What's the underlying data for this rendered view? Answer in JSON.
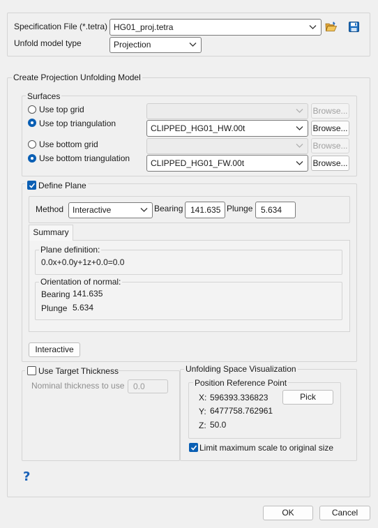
{
  "spec": {
    "label": "Specification File (*.tetra)",
    "value": "HG01_proj.tetra",
    "open_icon": "folder-open-icon",
    "save_icon": "save-icon"
  },
  "unfold": {
    "label": "Unfold model type",
    "value": "Projection"
  },
  "create": {
    "title": "Create Projection Unfolding Model",
    "surfaces": {
      "title": "Surfaces",
      "top_grid": {
        "label": "Use top grid",
        "value": "",
        "browse": "Browse...",
        "selected": false
      },
      "top_tri": {
        "label": "Use top triangulation",
        "value": "CLIPPED_HG01_HW.00t",
        "browse": "Browse...",
        "selected": true
      },
      "bottom_grid": {
        "label": "Use bottom grid",
        "value": "",
        "browse": "Browse...",
        "selected": false
      },
      "bottom_tri": {
        "label": "Use bottom triangulation",
        "value": "CLIPPED_HG01_FW.00t",
        "browse": "Browse...",
        "selected": true
      }
    },
    "define_plane": {
      "label": "Define Plane",
      "checked": true,
      "method_label": "Method",
      "method_value": "Interactive",
      "bearing_label": "Bearing",
      "bearing_value": "141.635",
      "plunge_label": "Plunge",
      "plunge_value": "5.634",
      "tab": "Summary",
      "plane_def_title": "Plane definition:",
      "plane_def_value": "0.0x+0.0y+1z+0.0=0.0",
      "normal_title": "Orientation of normal:",
      "normal_bearing_label": "Bearing",
      "normal_bearing_value": "141.635",
      "normal_plunge_label": "Plunge",
      "normal_plunge_value": "5.634",
      "interactive_button": "Interactive"
    },
    "target": {
      "label": "Use Target Thickness",
      "checked": false,
      "nominal_label": "Nominal thickness to use",
      "nominal_value": "0.0"
    },
    "visual": {
      "title": "Unfolding Space Visualization",
      "ref_title": "Position Reference Point",
      "x_label": "X:",
      "x_value": "596393.336823",
      "y_label": "Y:",
      "y_value": "6477758.762961",
      "z_label": "Z:",
      "z_value": "50.0",
      "pick": "Pick",
      "limit_label": "Limit maximum scale to original size",
      "limit_checked": true
    }
  },
  "help_icon": "help-icon",
  "footer": {
    "ok": "OK",
    "cancel": "Cancel"
  },
  "colors": {
    "accent": "#0a5fb4",
    "background": "#f0f0f0"
  }
}
